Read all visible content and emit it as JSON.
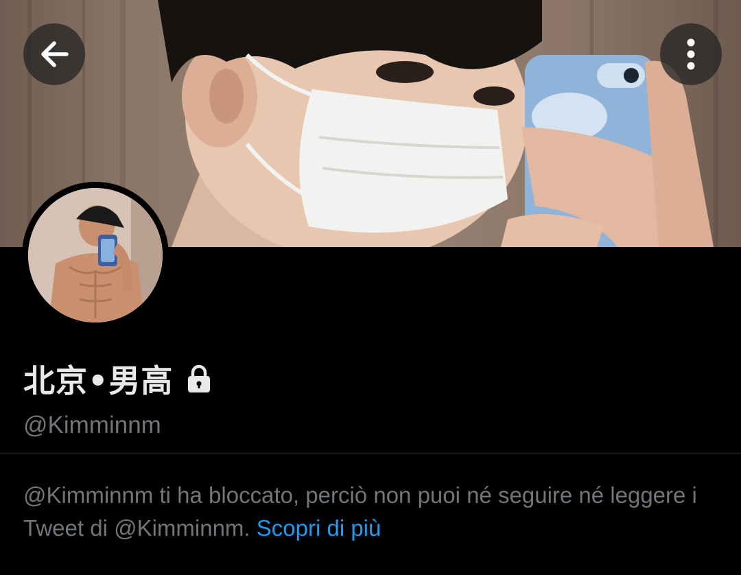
{
  "profile": {
    "display_name": "北京•男高",
    "handle": "@Kimminnm",
    "protected": true
  },
  "header": {
    "back_icon": "arrow-left-icon",
    "more_icon": "more-vertical-icon"
  },
  "blocked_notice": {
    "message": "@Kimminnm ti ha bloccato, perciò non puoi né seguire né leggere i Tweet di @Kimminnm.",
    "link_label": "Scopri di più"
  },
  "colors": {
    "background": "#000000",
    "primary_text": "#e7e9ea",
    "secondary_text": "#71767b",
    "link": "#1d9bf0",
    "divider": "#2f3336"
  }
}
